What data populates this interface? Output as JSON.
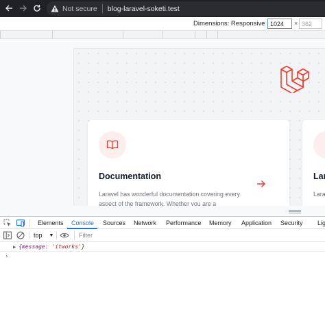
{
  "browser": {
    "security_label": "Not secure",
    "url": "blog-laravel-soketi.test"
  },
  "device_toolbar": {
    "dimensions_label": "Dimensions: Responsive",
    "width": "1024",
    "times": "×",
    "height": "362"
  },
  "page": {
    "cards": [
      {
        "title": "Documentation",
        "text": "Laravel has wonderful documentation covering every aspect of the framework. Whether you are a"
      },
      {
        "title": "Lar",
        "text": "Lara Lara"
      }
    ],
    "accent_color": "#ef3b2d"
  },
  "devtools": {
    "tabs": [
      "Elements",
      "Console",
      "Sources",
      "Network",
      "Performance",
      "Memory",
      "Application",
      "Security",
      "Lig"
    ],
    "active_tab": "Console",
    "context": "top",
    "filter_placeholder": "Filter",
    "log": {
      "open": "{",
      "key": "message",
      "colon": ": ",
      "value": "'itworks'",
      "close": "}"
    },
    "prompt": "›"
  }
}
